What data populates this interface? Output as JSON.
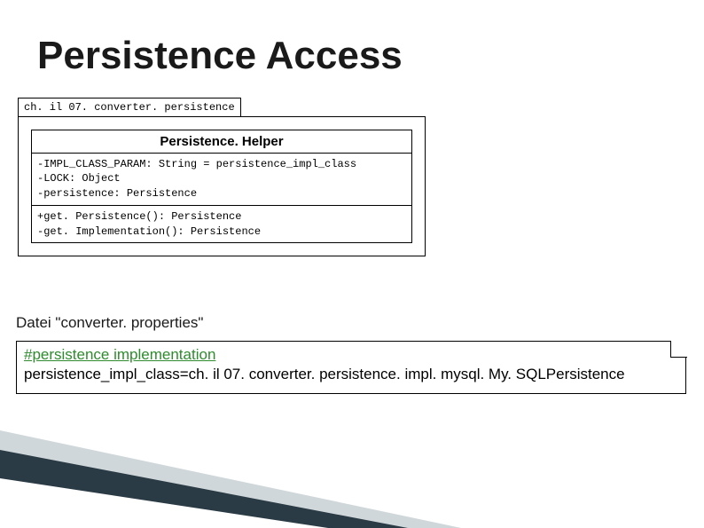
{
  "title": "Persistence Access",
  "uml": {
    "package_name": "ch. il 07. converter. persistence",
    "class_name": "Persistence. Helper",
    "attributes": [
      "-IMPL_CLASS_PARAM: String = persistence_impl_class",
      "-LOCK: Object",
      "-persistence: Persistence"
    ],
    "operations": [
      "+get. Persistence(): Persistence",
      "-get. Implementation(): Persistence"
    ]
  },
  "file_label": "Datei \"converter. properties\"",
  "properties": {
    "comment": "#persistence implementation",
    "line": "persistence_impl_class=ch. il 07. converter. persistence. impl. mysql. My. SQLPersistence"
  }
}
